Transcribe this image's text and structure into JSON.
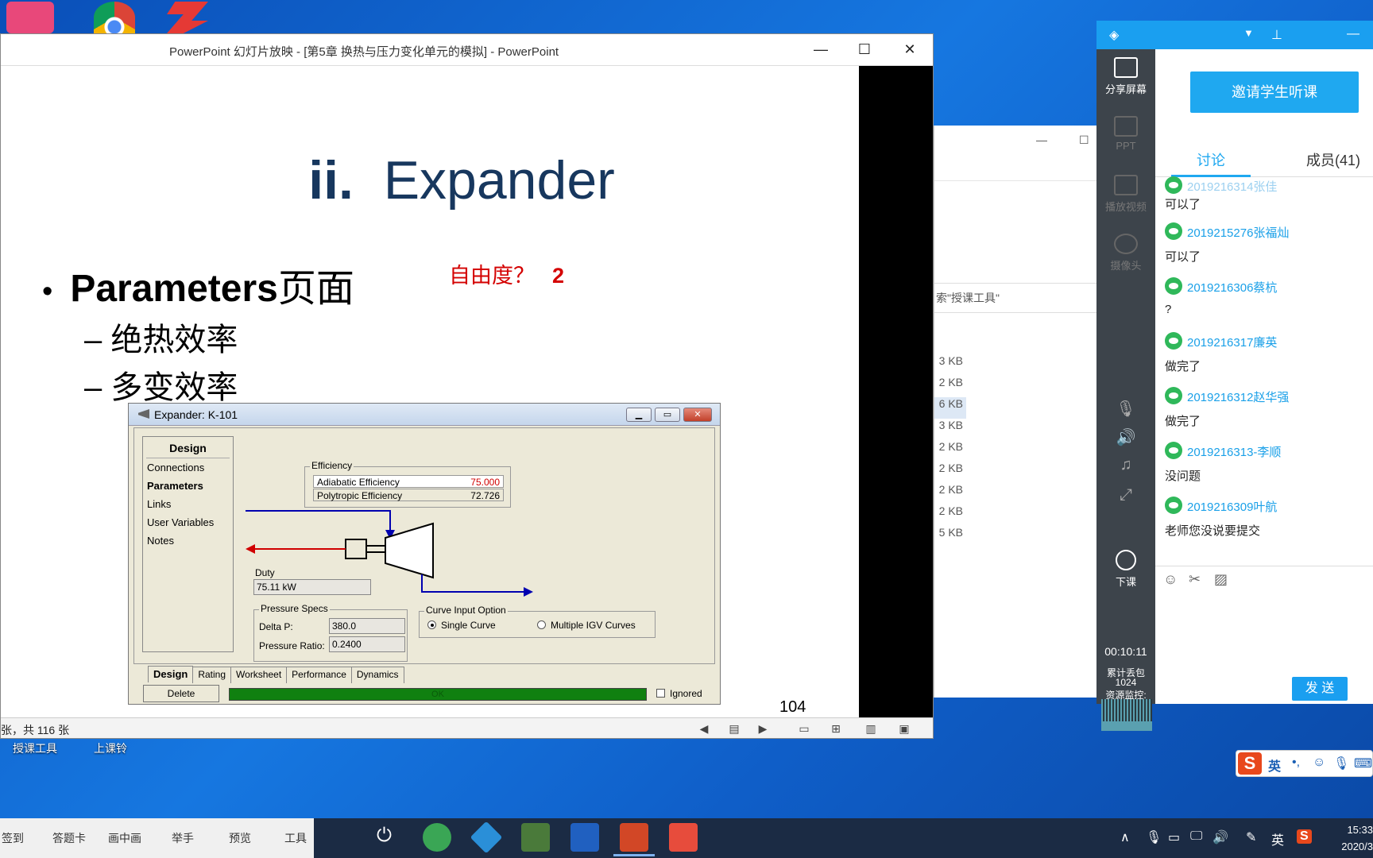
{
  "desktop": {
    "icons": [
      "app-icon",
      "chrome-icon",
      "app-icon"
    ],
    "labels": {
      "teach_tools": "授课工具",
      "class_bell": "上课铃"
    }
  },
  "explorer": {
    "search_text": "索\"授课工具\"",
    "sizes": [
      "3 KB",
      "2 KB",
      "6 KB",
      "3 KB",
      "2 KB",
      "2 KB",
      "2 KB",
      "2 KB",
      "5 KB"
    ]
  },
  "ppt": {
    "title": "PowerPoint 幻灯片放映 - [第5章 换热与压力变化单元的模拟] - PowerPoint",
    "status_text": "张，共 116 张",
    "slide": {
      "title_roman": "ii.",
      "title_text": "Expander",
      "bullet_bold": "Parameters",
      "bullet_rest": "页面",
      "sub1": "– 绝热效率",
      "sub2": "– 多变效率",
      "red_note": "自由度？",
      "red_num": "2",
      "page_number": "104"
    }
  },
  "hysys": {
    "title": "Expander: K-101",
    "nav_header": "Design",
    "nav_items": [
      "Connections",
      "Parameters",
      "Links",
      "User Variables",
      "Notes"
    ],
    "efficiency_label": "Efficiency",
    "adiabatic_label": "Adiabatic Efficiency",
    "adiabatic_value": "75.000",
    "polytropic_label": "Polytropic Efficiency",
    "polytropic_value": "72.726",
    "duty_label": "Duty",
    "duty_value": "75.11 kW",
    "pressure_specs_label": "Pressure Specs",
    "delta_p_label": "Delta P:",
    "delta_p_value": "380.0",
    "pressure_ratio_label": "Pressure Ratio:",
    "pressure_ratio_value": "0.2400",
    "curve_option_label": "Curve Input Option",
    "single_curve": "Single Curve",
    "multiple_curves": "Multiple IGV Curves",
    "tabs": [
      "Design",
      "Rating",
      "Worksheet",
      "Performance",
      "Dynamics"
    ],
    "delete_label": "Delete",
    "ok_label": "OK",
    "ignored_label": "Ignored"
  },
  "teach_panel": {
    "tools": [
      "分享屏幕",
      "PPT",
      "播放视频",
      "摄像头"
    ],
    "end_class": "下课",
    "timer": "00:10:11",
    "packet_loss_label": "累计丢包",
    "packet_loss_value": "1024",
    "monitor_label": "资源监控:",
    "invite_button": "邀请学生听课",
    "tab_discuss": "讨论",
    "tab_members": "成员(41)",
    "messages": [
      {
        "name": "2019216314张佳",
        "text": "可以了"
      },
      {
        "name": "2019215276张福灿",
        "text": "可以了"
      },
      {
        "name": "2019216306蔡杭",
        "text": "?"
      },
      {
        "name": "2019216317廉英",
        "text": "做完了"
      },
      {
        "name": "2019216312赵华强",
        "text": "做完了"
      },
      {
        "name": "2019216313-李顺",
        "text": "没问题"
      },
      {
        "name": "2019216309叶航",
        "text": "老师您没说要提交"
      }
    ],
    "send_button": "发 送"
  },
  "ime": {
    "lang": "英"
  },
  "taskbar": {
    "left_items": [
      "签到",
      "答题卡",
      "画中画",
      "举手",
      "预览",
      "工具"
    ],
    "tray_lang": "英",
    "time": "15:33",
    "date": "2020/3"
  }
}
